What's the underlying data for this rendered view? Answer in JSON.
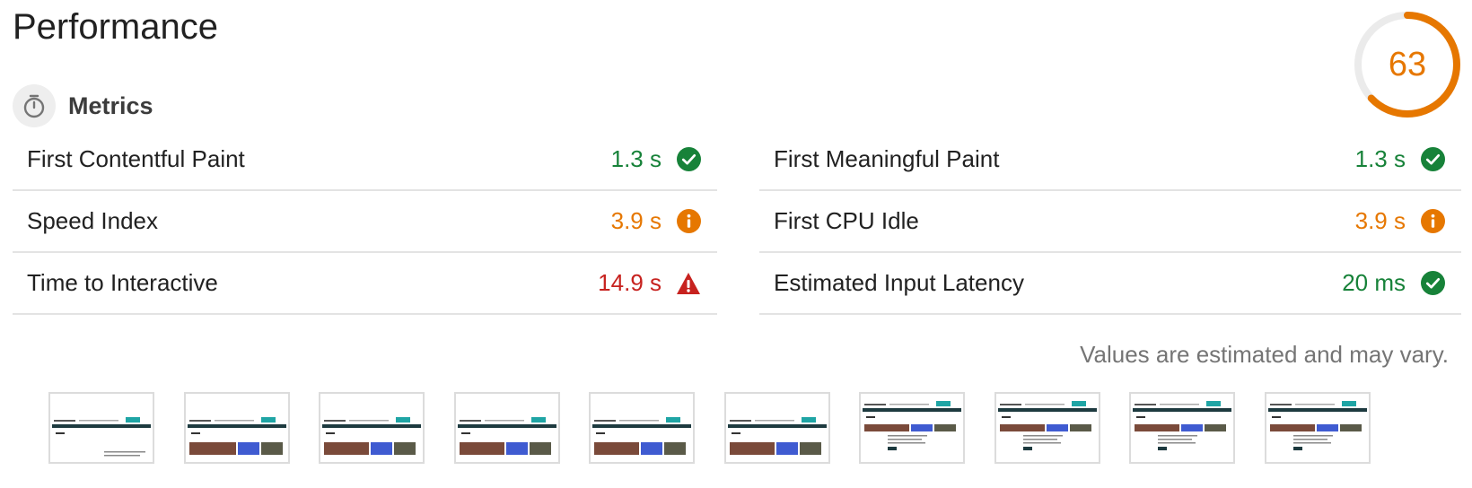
{
  "header": {
    "title": "Performance"
  },
  "score": {
    "value": "63",
    "fraction": 0.63,
    "color": "#e67700"
  },
  "metrics": {
    "label": "Metrics",
    "left": [
      {
        "label": "First Contentful Paint",
        "value": "1.3 s",
        "status": "pass"
      },
      {
        "label": "Speed Index",
        "value": "3.9 s",
        "status": "average"
      },
      {
        "label": "Time to Interactive",
        "value": "14.9 s",
        "status": "fail"
      }
    ],
    "right": [
      {
        "label": "First Meaningful Paint",
        "value": "1.3 s",
        "status": "pass"
      },
      {
        "label": "First CPU Idle",
        "value": "3.9 s",
        "status": "average"
      },
      {
        "label": "Estimated Input Latency",
        "value": "20 ms",
        "status": "pass"
      }
    ]
  },
  "note": "Values are estimated and may vary.",
  "colors": {
    "pass": "#178239",
    "average": "#e67700",
    "fail": "#c7221f"
  },
  "icons": {
    "pass": "check-circle-icon",
    "average": "info-circle-icon",
    "fail": "warning-triangle-icon",
    "metrics": "stopwatch-icon"
  },
  "filmstrip": {
    "frames": [
      {
        "stage": "header"
      },
      {
        "stage": "partial-images"
      },
      {
        "stage": "images"
      },
      {
        "stage": "images"
      },
      {
        "stage": "images"
      },
      {
        "stage": "images"
      },
      {
        "stage": "complete"
      },
      {
        "stage": "complete"
      },
      {
        "stage": "complete"
      },
      {
        "stage": "complete"
      }
    ]
  }
}
